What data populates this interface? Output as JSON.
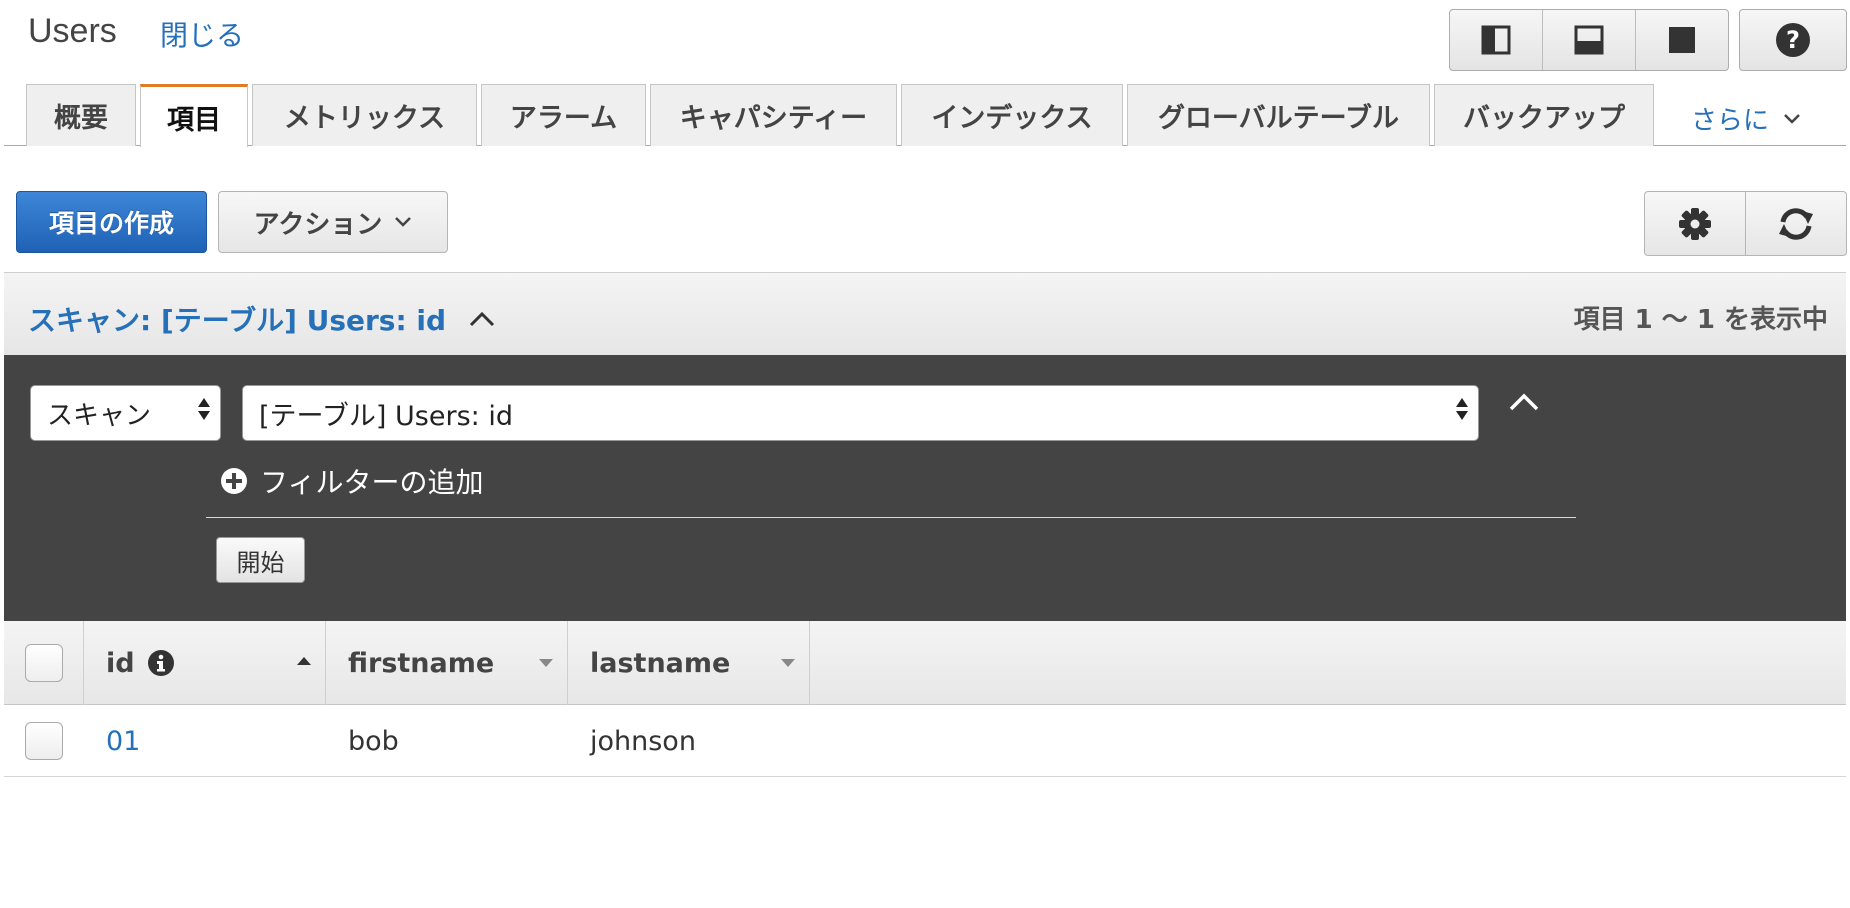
{
  "header": {
    "title": "Users",
    "close_label": "閉じる",
    "view_buttons": [
      "split-vertical-icon",
      "split-horizontal-icon",
      "full-icon"
    ],
    "help_icon": "question-icon"
  },
  "tabs": {
    "items": [
      {
        "label": "概要"
      },
      {
        "label": "項目"
      },
      {
        "label": "メトリックス"
      },
      {
        "label": "アラーム"
      },
      {
        "label": "キャパシティー"
      },
      {
        "label": "インデックス"
      },
      {
        "label": "グローバルテーブル"
      },
      {
        "label": "バックアップ"
      }
    ],
    "active": "項目",
    "more_label": "さらに"
  },
  "toolbar": {
    "create_label": "項目の作成",
    "action_label": "アクション",
    "settings_icon": "gear-icon",
    "refresh_icon": "refresh-icon"
  },
  "scan": {
    "title": "スキャン: [テーブル] Users: id",
    "count_label": "項目 1 〜 1 を表示中",
    "mode_value": "スキャン",
    "table_value": "[テーブル] Users: id",
    "add_filter_label": "フィルターの追加",
    "start_label": "開始"
  },
  "table": {
    "columns": [
      {
        "label": "id"
      },
      {
        "label": "firstname"
      },
      {
        "label": "lastname"
      }
    ],
    "rows": [
      {
        "id": "01",
        "firstname": "bob",
        "lastname": "johnson"
      }
    ]
  },
  "colors": {
    "accent": "#2670b8",
    "tab_active": "#e07b26",
    "panel": "#444444"
  }
}
